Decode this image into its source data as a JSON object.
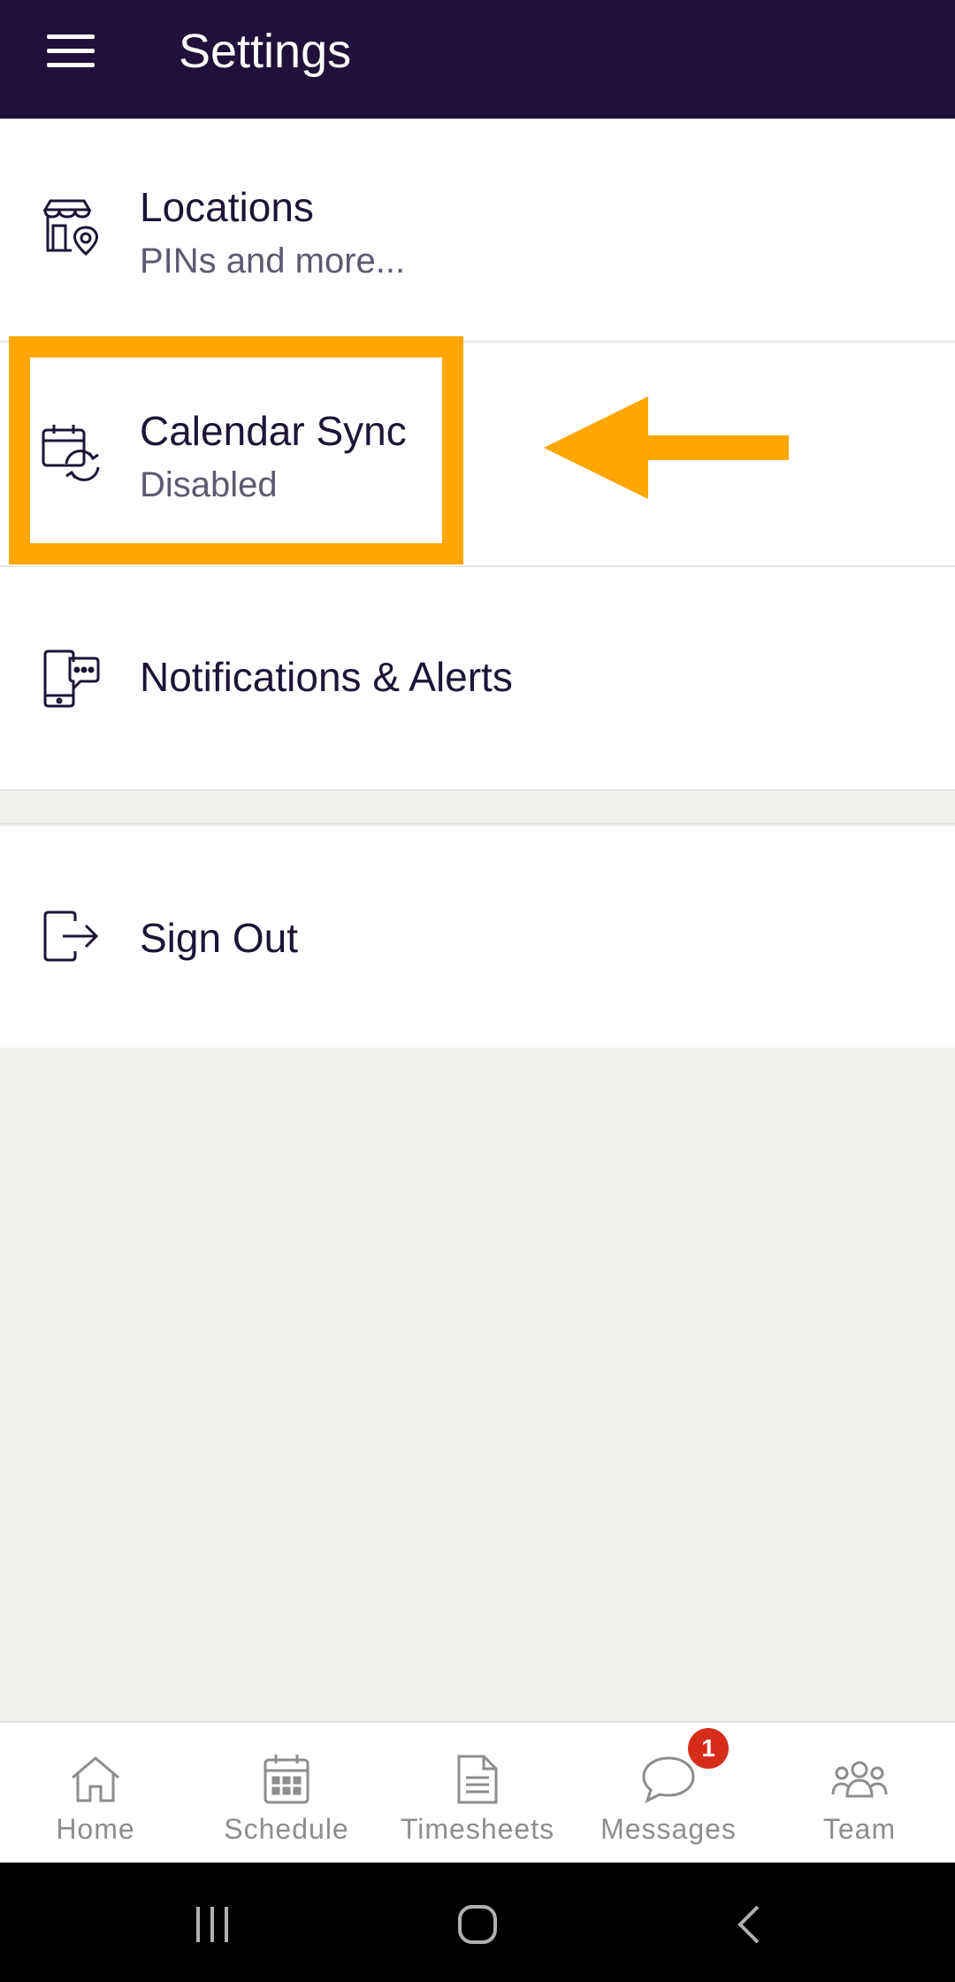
{
  "header": {
    "title": "Settings",
    "menu_icon": "hamburger-menu-icon"
  },
  "settings": [
    {
      "icon": "store-location-icon",
      "title": "Locations",
      "subtitle": "PINs and more..."
    },
    {
      "icon": "calendar-sync-icon",
      "title": "Calendar Sync",
      "subtitle": "Disabled"
    },
    {
      "icon": "phone-chat-icon",
      "title": "Notifications & Alerts",
      "subtitle": ""
    }
  ],
  "signout": {
    "icon": "sign-out-icon",
    "label": "Sign Out"
  },
  "annotation": {
    "color": "#ffa600"
  },
  "bottom_nav": [
    {
      "icon": "home-icon",
      "label": "Home"
    },
    {
      "icon": "calendar-icon",
      "label": "Schedule"
    },
    {
      "icon": "document-icon",
      "label": "Timesheets"
    },
    {
      "icon": "chat-bubble-icon",
      "label": "Messages",
      "badge": "1"
    },
    {
      "icon": "team-icon",
      "label": "Team"
    }
  ],
  "colors": {
    "header_bg": "#1f1139",
    "text": "#1e1437",
    "badge": "#d62d1a"
  }
}
